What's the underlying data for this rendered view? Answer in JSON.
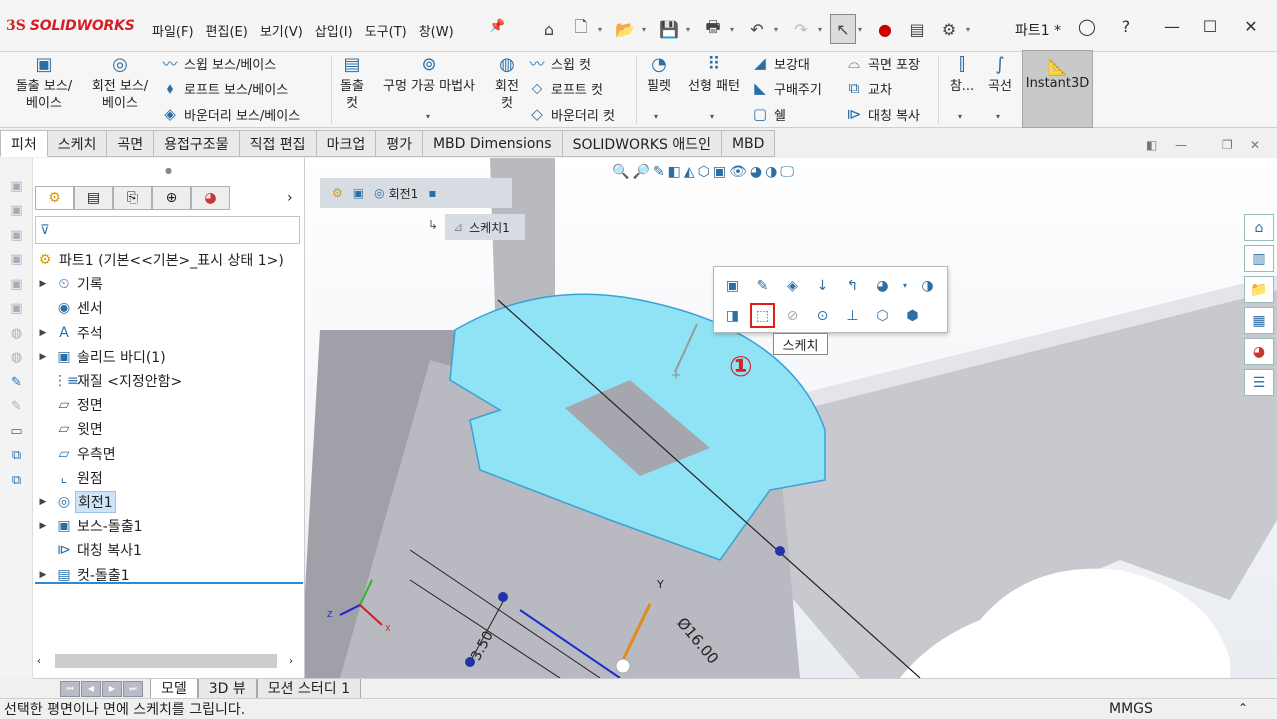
{
  "app": {
    "brand_mark": "3S",
    "brand_name": "SOLIDWORKS",
    "document_title": "파트1 *"
  },
  "menu": [
    "파일(F)",
    "편집(E)",
    "보기(V)",
    "삽입(I)",
    "도구(T)",
    "창(W)"
  ],
  "ribbon": {
    "extruded_boss": "돌출 보스/\n베이스",
    "revolved_boss": "회전 보스/\n베이스",
    "swept_boss": "스윕 보스/베이스",
    "lofted_boss": "로프트 보스/베이스",
    "boundary_boss": "바운더리 보스/베이스",
    "extruded_cut": "돌출\n컷",
    "hole_wizard": "구멍 가공 마법사",
    "revolved_cut": "회전\n컷",
    "swept_cut": "스윕 컷",
    "lofted_cut": "로프트 컷",
    "boundary_cut": "바운더리 컷",
    "fillet": "필렛",
    "linear_pattern": "선형 패턴",
    "rib": "보강대",
    "draft": "구배주기",
    "shell": "쉘",
    "wrap": "곡면 포장",
    "intersect": "교차",
    "mirror": "대칭 복사",
    "reference": "참...",
    "curves": "곡선",
    "instant3d": "Instant3D"
  },
  "tabs": [
    "피처",
    "스케치",
    "곡면",
    "용접구조물",
    "직접 편집",
    "마크업",
    "평가",
    "MBD Dimensions",
    "SOLIDWORKS 애드인",
    "MBD"
  ],
  "active_tab": "피처",
  "tree": {
    "root": "파트1 (기본<<기본>_표시 상태 1>)",
    "items": [
      {
        "label": "기록",
        "icon": "history-icon",
        "expandable": true
      },
      {
        "label": "센서",
        "icon": "sensor-icon",
        "expandable": false
      },
      {
        "label": "주석",
        "icon": "annotation-icon",
        "expandable": true
      },
      {
        "label": "솔리드 바디(1)",
        "icon": "solid-body-icon",
        "expandable": true
      },
      {
        "label": "재질 <지정안함>",
        "icon": "material-icon",
        "expandable": false
      },
      {
        "label": "정면",
        "icon": "plane-icon",
        "expandable": false
      },
      {
        "label": "윗면",
        "icon": "plane-icon",
        "expandable": false
      },
      {
        "label": "우측면",
        "icon": "plane-icon",
        "expandable": false
      },
      {
        "label": "원점",
        "icon": "origin-icon",
        "expandable": false
      },
      {
        "label": "회전1",
        "icon": "revolve-icon",
        "expandable": true,
        "selected": true
      },
      {
        "label": "보스-돌출1",
        "icon": "extrude-icon",
        "expandable": true
      },
      {
        "label": "대칭 복사1",
        "icon": "mirror-icon",
        "expandable": false
      },
      {
        "label": "컷-돌출1",
        "icon": "cut-extrude-icon",
        "expandable": true
      }
    ]
  },
  "breadcrumb": {
    "feature": "회전1",
    "sketch": "스케치1"
  },
  "context_toolbar": {
    "tooltip": "스케치",
    "callout": "①"
  },
  "viewport": {
    "dimension_diameter": "Ø16.00",
    "dimension_linear": "3.50",
    "axis_y": "Y",
    "axis_x": "X",
    "axis_z": "Z"
  },
  "bottom_tabs": [
    "모델",
    "3D 뷰",
    "모션 스터디 1"
  ],
  "active_bottom_tab": "모델",
  "status": {
    "message": "선택한 평면이나 면에 스케치를 그립니다.",
    "units": "MMGS"
  },
  "colors": {
    "brand": "#d51e26",
    "selection_face": "#8fe3f4",
    "highlight": "#e01e1e",
    "accent": "#2d6ea5"
  }
}
